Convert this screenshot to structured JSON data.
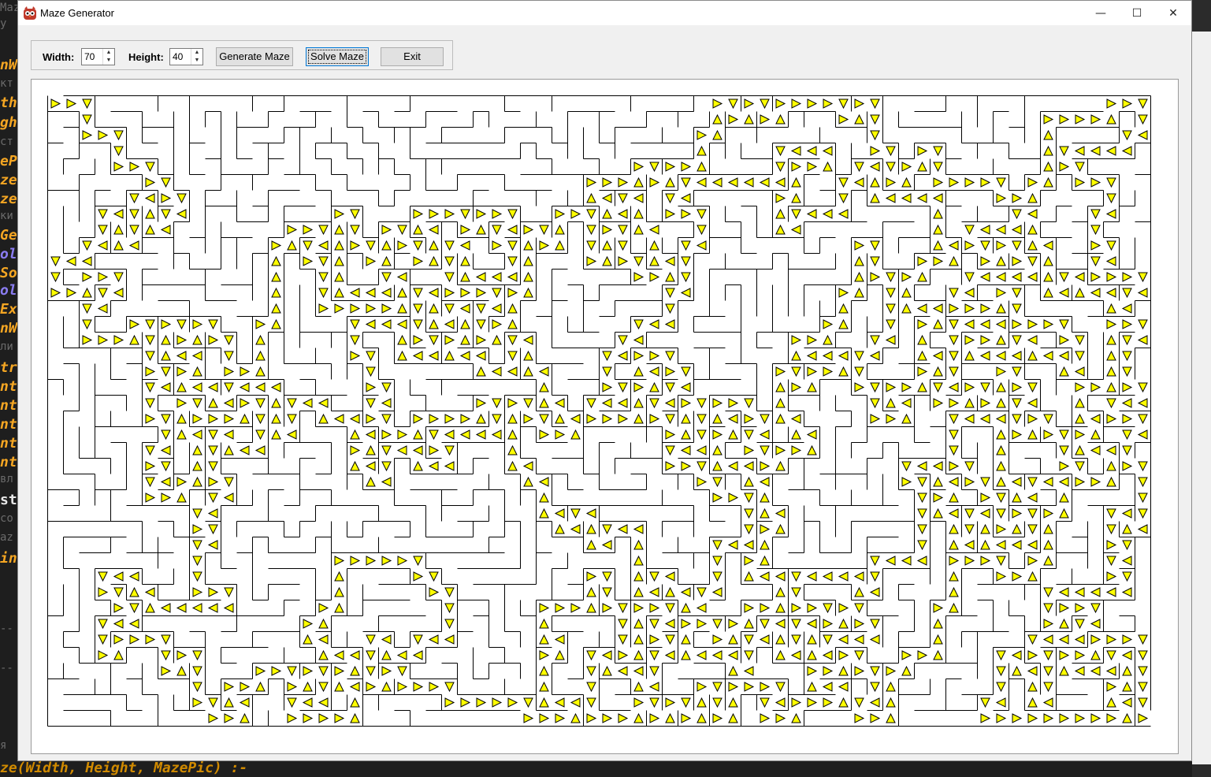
{
  "window": {
    "title": "Maze Generator"
  },
  "window_controls": {
    "minimize": "—",
    "maximize": "☐",
    "close": "✕"
  },
  "toolbar": {
    "width_label": "Width:",
    "width_value": "70",
    "height_label": "Height:",
    "height_value": "40",
    "generate_label": "Generate Maze",
    "solve_label": "Solve Maze",
    "exit_label": "Exit"
  },
  "maze": {
    "columns": 70,
    "rows": 40,
    "marker_color": "#ffff00",
    "wall_color": "#000000"
  },
  "background_editor": {
    "lines": [
      "Maz",
      "y",
      "nW",
      "кт",
      "th",
      "gh",
      "ст",
      "eP",
      "ze",
      "ze",
      "ки",
      "Ge",
      "ol",
      "So",
      "ol",
      "Ex",
      "nW",
      "ли",
      "tr",
      "nt",
      "nt",
      "nt",
      "nt",
      "nt",
      "вл",
      "st",
      "co",
      "az",
      "in",
      "--",
      "--",
      "я"
    ],
    "bottom_line": "ze(Width, Height, MazePic) :-"
  }
}
